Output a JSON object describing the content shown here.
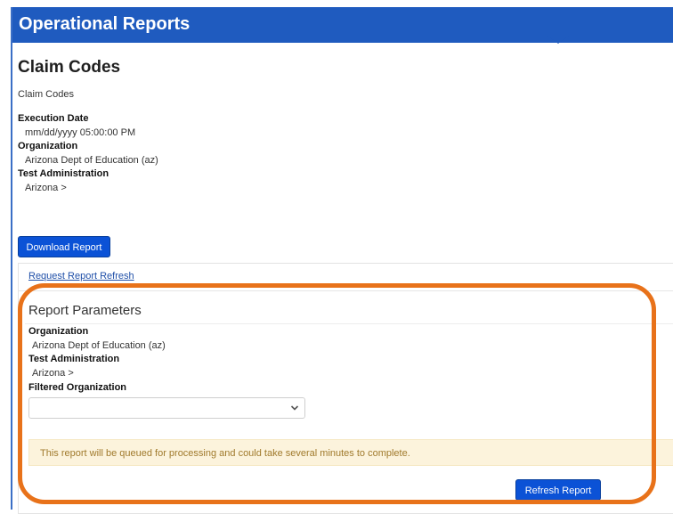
{
  "header": {
    "title": "Operational Reports"
  },
  "report": {
    "title": "Claim Codes",
    "subtitle": "Claim Codes",
    "execution_date_label": "Execution Date",
    "execution_date_value": "mm/dd/yyyy  05:00:00 PM",
    "organization_label": "Organization",
    "organization_value": "Arizona Dept of Education (az)",
    "test_admin_label": "Test Administration",
    "test_admin_value": "Arizona >"
  },
  "actions": {
    "download_label": "Download Report",
    "request_refresh_link": "Request Report Refresh"
  },
  "parameters": {
    "title": "Report Parameters",
    "organization_label": "Organization",
    "organization_value": "Arizona Dept of Education (az)",
    "test_admin_label": "Test Administration",
    "test_admin_value": "Arizona >",
    "filtered_org_label": "Filtered Organization",
    "filtered_org_value": "",
    "notice": "This report will be queued for processing and could take several minutes to complete.",
    "refresh_button_label": "Refresh Report"
  },
  "colors": {
    "header_bg": "#1f5bbf",
    "button_bg": "#0b52d6",
    "notice_bg": "#fcf3dc",
    "notice_text": "#a07a2c",
    "highlight_ring": "#e8721a"
  },
  "icons": {
    "select_arrow": "chevron-down-icon"
  }
}
